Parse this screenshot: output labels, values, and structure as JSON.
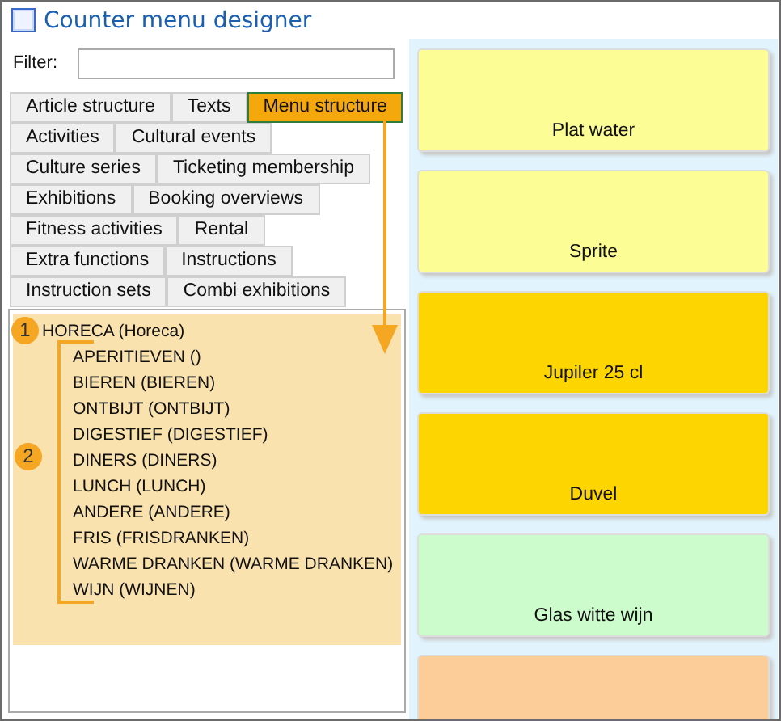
{
  "window": {
    "title": "Counter menu designer"
  },
  "filter": {
    "label": "Filter:"
  },
  "tab_rows": [
    {
      "tabs": [
        {
          "label": "Article structure",
          "selected": false
        },
        {
          "label": "Texts",
          "selected": false
        },
        {
          "label": "Menu structure",
          "selected": true
        }
      ]
    },
    {
      "tabs": [
        {
          "label": "Activities",
          "selected": false
        },
        {
          "label": "Cultural events",
          "selected": false
        }
      ]
    },
    {
      "tabs": [
        {
          "label": "Culture series",
          "selected": false
        },
        {
          "label": "Ticketing membership",
          "selected": false
        }
      ]
    },
    {
      "tabs": [
        {
          "label": "Exhibitions",
          "selected": false
        },
        {
          "label": "Booking overviews",
          "selected": false
        }
      ]
    },
    {
      "tabs": [
        {
          "label": "Fitness activities",
          "selected": false
        },
        {
          "label": "Rental",
          "selected": false
        }
      ]
    },
    {
      "tabs": [
        {
          "label": "Extra functions",
          "selected": false
        },
        {
          "label": "Instructions",
          "selected": false
        }
      ]
    },
    {
      "tabs": [
        {
          "label": "Instruction sets",
          "selected": false
        },
        {
          "label": "Combi exhibitions",
          "selected": false
        }
      ]
    }
  ],
  "tree": [
    {
      "label": "HORECA (Horeca)",
      "children": [
        {
          "label": "APERITIEVEN ()"
        },
        {
          "label": "BIEREN (BIEREN)"
        },
        {
          "label": "ONTBIJT (ONTBIJT)"
        },
        {
          "label": "DIGESTIEF (DIGESTIEF)"
        },
        {
          "label": "DINERS (DINERS)"
        },
        {
          "label": "LUNCH (LUNCH)"
        },
        {
          "label": "ANDERE (ANDERE)"
        },
        {
          "label": "FRIS (FRISDRANKEN)"
        },
        {
          "label": "WARME DRANKEN (WARME DRANKEN)"
        },
        {
          "label": "WIJN (WIJNEN)"
        }
      ]
    }
  ],
  "callouts": [
    "1",
    "2"
  ],
  "tiles": [
    {
      "label": "Plat water",
      "color": "#fdfd96"
    },
    {
      "label": "Sprite",
      "color": "#fdfd96"
    },
    {
      "label": "Jupiler 25 cl",
      "color": "#fdd500"
    },
    {
      "label": "Duvel",
      "color": "#fdd500"
    },
    {
      "label": "Glas witte wijn",
      "color": "#ccfccc"
    },
    {
      "color": "#fccc99"
    }
  ]
}
